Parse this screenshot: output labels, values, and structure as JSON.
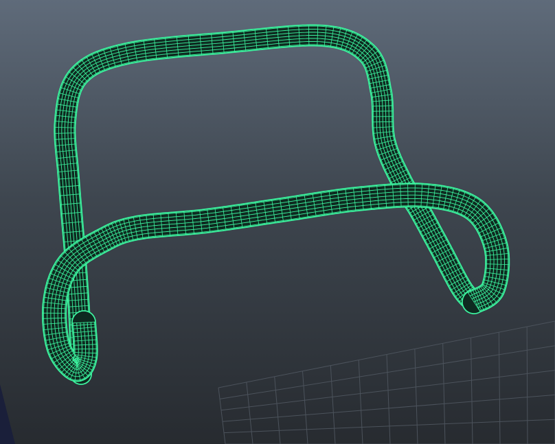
{
  "viewport": {
    "background_top_color": "#5f6b7a",
    "background_bottom_color": "#272b30",
    "grid_color": "#4c535c"
  },
  "model": {
    "object": "wireframe-tube-chair-frame",
    "wire_color": "#3df5a0",
    "wire_dark_color": "#0e2a20"
  }
}
